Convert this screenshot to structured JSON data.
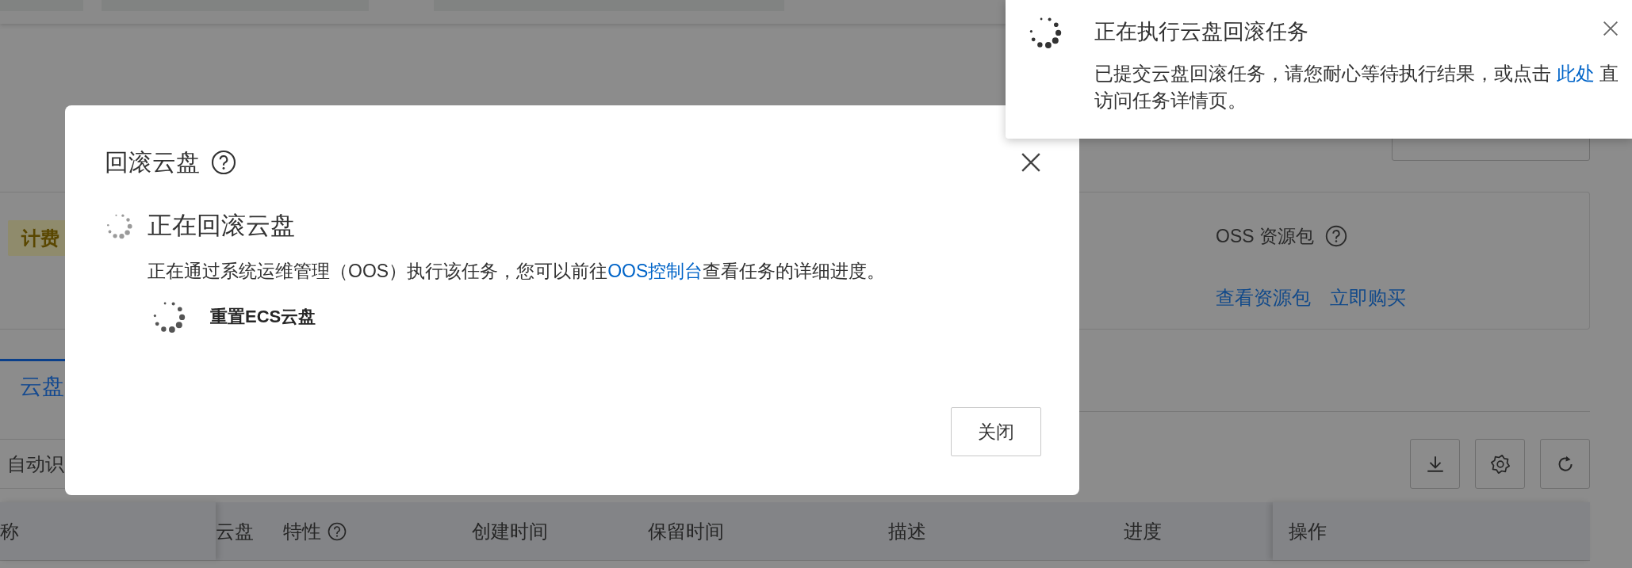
{
  "page": {
    "billing_badge": {
      "label": "计费"
    },
    "oss_package": {
      "title": "OSS 资源包",
      "links": [
        "查看资源包",
        "立即购买"
      ]
    },
    "tabs": [
      {
        "label": "云盘",
        "selected": true
      }
    ],
    "filter": {
      "value": "自动识"
    },
    "table": {
      "columns": [
        {
          "label": "称",
          "help": false
        },
        {
          "label": "云盘",
          "help": false
        },
        {
          "label": "特性",
          "help": true
        },
        {
          "label": "创建时间",
          "help": false
        },
        {
          "label": "保留时间",
          "help": false
        },
        {
          "label": "描述",
          "help": false
        },
        {
          "label": "进度",
          "help": false
        },
        {
          "label": "操作",
          "help": false
        }
      ]
    }
  },
  "dialog": {
    "title": "回滚云盘",
    "heading": "正在回滚云盘",
    "description": {
      "before": "正在通过系统运维管理（OOS）执行该任务，您可以前往",
      "link": "OOS控制台",
      "after": "查看任务的详细进度。"
    },
    "steps": [
      {
        "label": "重置ECS云盘"
      }
    ],
    "buttons": [
      "关闭"
    ]
  },
  "notification": {
    "title": "正在执行云盘回滚任务",
    "message": {
      "before": "已提交云盘回滚任务，请您耐心等待执行结果，或点击 ",
      "link": "此处",
      "after": " 直",
      "line_2": "访问任务详情页。"
    }
  }
}
